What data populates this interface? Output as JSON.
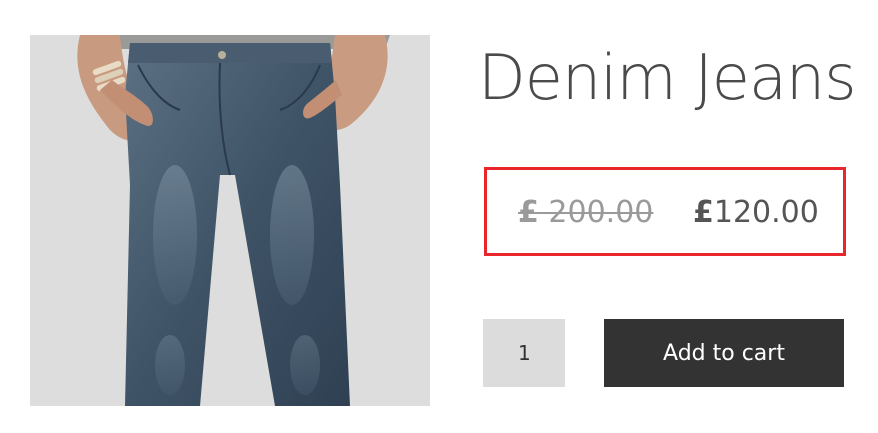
{
  "product": {
    "title": "Denim Jeans",
    "image_alt": "Denim Jeans",
    "price": {
      "currency_symbol": "£",
      "old_amount": " 200.00",
      "new_amount": "120.00",
      "highlight_color": "#e8262b"
    },
    "quantity": {
      "value": "1"
    },
    "add_to_cart_label": "Add to cart"
  },
  "colors": {
    "button_bg": "#333333",
    "image_bg": "#dddddd",
    "quantity_bg": "#dcdcdc",
    "title_color": "#4a4a4a"
  }
}
